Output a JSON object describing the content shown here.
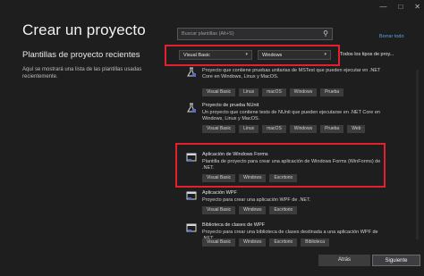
{
  "window_controls": {
    "minimize": "—",
    "maximize": "□",
    "close": "✕"
  },
  "page": {
    "title": "Crear un proyecto"
  },
  "recent": {
    "title": "Plantillas de proyecto recientes",
    "description": "Aquí se mostrará una lista de las plantillas usadas recientemente."
  },
  "search": {
    "placeholder": "Buscar plantillas (Alt+S)"
  },
  "clear_all": "Borrar todo",
  "filters": {
    "language": "Visual Basic",
    "platform": "Windows",
    "project_type": "Todos los tipos de proy..."
  },
  "templates": [
    {
      "name": "",
      "description": "Proyecto que contiene pruebas unitarias de MSTest que pueden ejecutar en .NET Core en Windows, Linux y MacOS.",
      "tags": [
        "Visual Basic",
        "Linux",
        "macOS",
        "Windows",
        "Prueba"
      ]
    },
    {
      "name": "Proyecto de prueba NUnit",
      "description": "Un proyecto que contiene tests de NUnit que pueden ejecutarse en .NET Core en Windows, Linux y MacOS.",
      "tags": [
        "Visual Basic",
        "Linux",
        "macOS",
        "Windows",
        "Prueba",
        "Web"
      ]
    },
    {
      "name": "Aplicación de Windows Forms",
      "description": "Plantilla de proyecto para crear una aplicación de Windows Forms (WinForms) de .NET.",
      "tags": [
        "Visual Basic",
        "Windows",
        "Escritorio"
      ]
    },
    {
      "name": "Aplicación WPF",
      "description": "Proyecto para crear una aplicación WPF de .NET.",
      "tags": [
        "Visual Basic",
        "Windows",
        "Escritorio"
      ]
    },
    {
      "name": "Biblioteca de clases de WPF",
      "description": "Proyecto para crear una biblioteca de clases destinada a una aplicación WPF de .NET.",
      "tags": [
        "Visual Basic",
        "Windows",
        "Escritorio",
        "Biblioteca"
      ]
    }
  ],
  "buttons": {
    "back": "Atrás",
    "next": "Siguiente"
  },
  "colors": {
    "background": "#1e1e1e",
    "highlight_border": "#e3202b",
    "link": "#5fa3e6"
  }
}
